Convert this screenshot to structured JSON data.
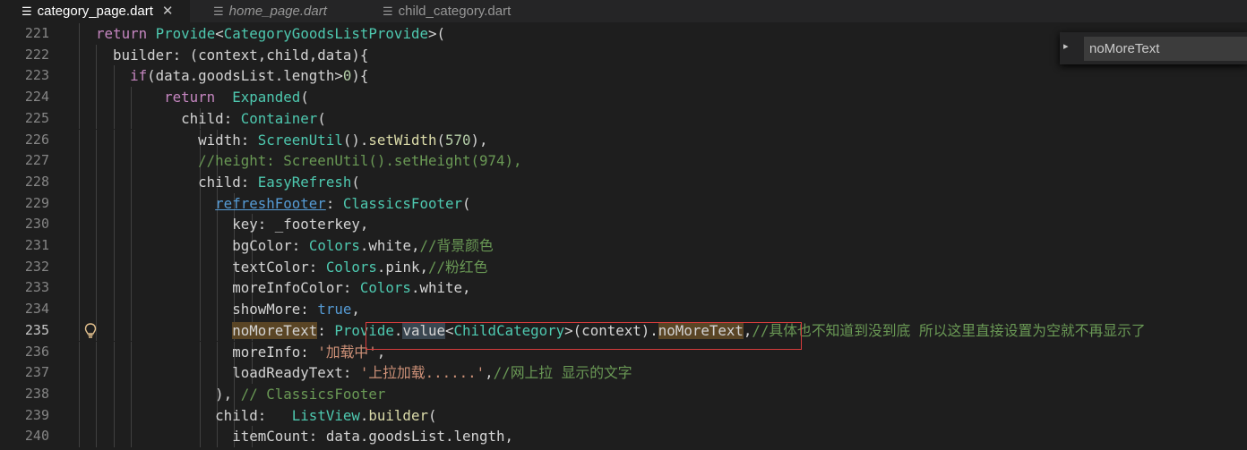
{
  "tabs": [
    {
      "label": "category_page.dart",
      "active": true,
      "icon": "lines-icon",
      "close": "✕"
    },
    {
      "label": "home_page.dart",
      "active": false,
      "preview": true,
      "icon": "lines-icon"
    },
    {
      "label": "child_category.dart",
      "active": false,
      "icon": "lines-icon"
    }
  ],
  "find": {
    "value": "noMoreText",
    "toggle": "▸"
  },
  "lines": [
    {
      "n": "221",
      "depth": 1,
      "tokens": [
        [
          "ws",
          "  "
        ],
        [
          "kw",
          "return"
        ],
        [
          "p",
          " "
        ],
        [
          "ty",
          "Provide"
        ],
        [
          "p",
          "<"
        ],
        [
          "ty",
          "CategoryGoodsListProvide"
        ],
        [
          "p",
          ">("
        ]
      ]
    },
    {
      "n": "222",
      "depth": 2,
      "tokens": [
        [
          "ws",
          "    "
        ],
        [
          "p",
          "builder: (context,child,data){"
        ]
      ]
    },
    {
      "n": "223",
      "depth": 3,
      "tokens": [
        [
          "ws",
          "      "
        ],
        [
          "kw",
          "if"
        ],
        [
          "p",
          "(data.goodsList.length>"
        ],
        [
          "num",
          "0"
        ],
        [
          "p",
          "){"
        ]
      ]
    },
    {
      "n": "224",
      "depth": 4,
      "tokens": [
        [
          "ws",
          "          "
        ],
        [
          "kw",
          "return"
        ],
        [
          "p",
          "  "
        ],
        [
          "ty",
          "Expanded"
        ],
        [
          "p",
          "("
        ]
      ]
    },
    {
      "n": "225",
      "depth": 5,
      "tokens": [
        [
          "ws",
          "            "
        ],
        [
          "p",
          "child: "
        ],
        [
          "ty",
          "Container"
        ],
        [
          "p",
          "("
        ]
      ]
    },
    {
      "n": "226",
      "depth": 6,
      "tokens": [
        [
          "ws",
          "              "
        ],
        [
          "p",
          "width: "
        ],
        [
          "ty",
          "ScreenUtil"
        ],
        [
          "p",
          "()."
        ],
        [
          "fn",
          "setWidth"
        ],
        [
          "p",
          "("
        ],
        [
          "num",
          "570"
        ],
        [
          "p",
          "),"
        ]
      ]
    },
    {
      "n": "227",
      "depth": 6,
      "tokens": [
        [
          "ws",
          "              "
        ],
        [
          "cm",
          "//height: ScreenUtil().setHeight(974),"
        ]
      ]
    },
    {
      "n": "228",
      "depth": 6,
      "tokens": [
        [
          "ws",
          "              "
        ],
        [
          "p",
          "child: "
        ],
        [
          "ty",
          "EasyRefresh"
        ],
        [
          "p",
          "("
        ]
      ]
    },
    {
      "n": "229",
      "depth": 7,
      "tokens": [
        [
          "ws",
          "                "
        ],
        [
          "ulink",
          "refreshFooter"
        ],
        [
          "p",
          ": "
        ],
        [
          "ty",
          "ClassicsFooter"
        ],
        [
          "p",
          "("
        ]
      ]
    },
    {
      "n": "230",
      "depth": 8,
      "tokens": [
        [
          "ws",
          "                  "
        ],
        [
          "p",
          "key: _footerkey,"
        ]
      ]
    },
    {
      "n": "231",
      "depth": 8,
      "tokens": [
        [
          "ws",
          "                  "
        ],
        [
          "p",
          "bgColor: "
        ],
        [
          "ty",
          "Colors"
        ],
        [
          "p",
          ".white,"
        ],
        [
          "cm",
          "//背景颜色"
        ]
      ]
    },
    {
      "n": "232",
      "depth": 8,
      "tokens": [
        [
          "ws",
          "                  "
        ],
        [
          "p",
          "textColor: "
        ],
        [
          "ty",
          "Colors"
        ],
        [
          "p",
          ".pink,"
        ],
        [
          "cm",
          "//粉红色"
        ]
      ]
    },
    {
      "n": "233",
      "depth": 8,
      "tokens": [
        [
          "ws",
          "                  "
        ],
        [
          "p",
          "moreInfoColor: "
        ],
        [
          "ty",
          "Colors"
        ],
        [
          "p",
          ".white,"
        ]
      ]
    },
    {
      "n": "234",
      "depth": 8,
      "tokens": [
        [
          "ws",
          "                  "
        ],
        [
          "p",
          "showMore: "
        ],
        [
          "boolk",
          "true"
        ],
        [
          "p",
          ","
        ]
      ]
    },
    {
      "n": "235",
      "depth": 8,
      "current": true,
      "bulb": true,
      "tokens": [
        [
          "ws",
          "                  "
        ],
        [
          "hl",
          "noMoreText"
        ],
        [
          "p",
          ": "
        ],
        [
          "ty",
          "Provide"
        ],
        [
          "p",
          "."
        ],
        [
          "hl2",
          "value"
        ],
        [
          "p",
          "<"
        ],
        [
          "ty",
          "ChildCategory"
        ],
        [
          "p",
          ">(context)."
        ],
        [
          "hl",
          "noMoreText"
        ],
        [
          "p",
          ","
        ],
        [
          "cm",
          "//具体也不知道到没到底 所以这里直接设置为空就不再显示了"
        ]
      ]
    },
    {
      "n": "236",
      "depth": 8,
      "tokens": [
        [
          "ws",
          "                  "
        ],
        [
          "p",
          "moreInfo: "
        ],
        [
          "str",
          "'加载中'"
        ],
        [
          "p",
          ","
        ]
      ]
    },
    {
      "n": "237",
      "depth": 8,
      "tokens": [
        [
          "ws",
          "                  "
        ],
        [
          "p",
          "loadReadyText: "
        ],
        [
          "str",
          "'上拉加载......'"
        ],
        [
          "p",
          ","
        ],
        [
          "cm",
          "//网上拉 显示的文字"
        ]
      ]
    },
    {
      "n": "238",
      "depth": 7,
      "tokens": [
        [
          "ws",
          "                "
        ],
        [
          "p",
          "), "
        ],
        [
          "cm",
          "// ClassicsFooter"
        ]
      ]
    },
    {
      "n": "239",
      "depth": 7,
      "tokens": [
        [
          "ws",
          "                "
        ],
        [
          "p",
          "child:   "
        ],
        [
          "ty",
          "ListView"
        ],
        [
          "p",
          "."
        ],
        [
          "fn",
          "builder"
        ],
        [
          "p",
          "("
        ]
      ]
    },
    {
      "n": "240",
      "depth": 8,
      "tokens": [
        [
          "ws",
          "                  "
        ],
        [
          "p",
          "itemCount: data.goodsList.length,"
        ]
      ]
    }
  ]
}
